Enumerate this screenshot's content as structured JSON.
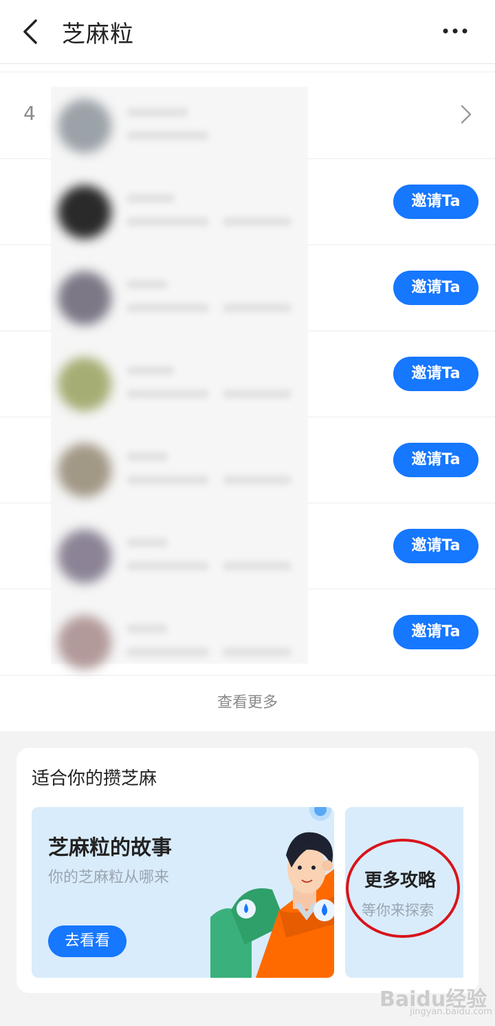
{
  "header": {
    "title": "芝麻粒"
  },
  "list": {
    "first_rank": "4",
    "invite_label": "邀请Ta",
    "see_more": "查看更多"
  },
  "card": {
    "title": "适合你的攒芝麻",
    "story": {
      "title": "芝麻粒的故事",
      "subtitle": "你的芝麻粒从哪来",
      "button": "去看看"
    },
    "guide": {
      "title": "更多攻略",
      "subtitle": "等你来探索"
    }
  },
  "watermark": {
    "logo": "Baidu经验",
    "url": "jingyan.baidu.com"
  },
  "colors": {
    "accent": "#1677ff",
    "annotation": "#d8141c",
    "section_bg": "#f3f3f3",
    "card_bg": "#d9ecfb"
  }
}
